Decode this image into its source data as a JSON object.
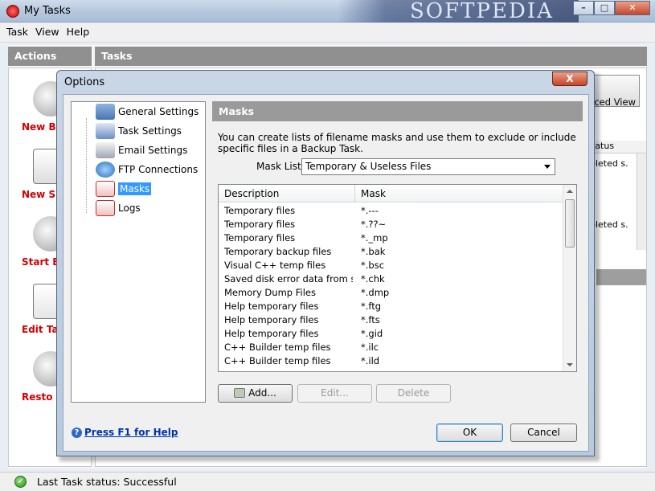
{
  "window": {
    "title": "My Tasks",
    "watermark": "SOFTPEDIA"
  },
  "menu": [
    "Task",
    "View",
    "Help"
  ],
  "actions_pane": {
    "header": "Actions",
    "items": [
      {
        "label": "New Ba",
        "icon": "cd-icon"
      },
      {
        "label": "New S",
        "icon": "new-task-icon"
      },
      {
        "label": "Start Ba",
        "icon": "start-backup-icon"
      },
      {
        "label": "Edit Ta",
        "icon": "edit-task-icon"
      },
      {
        "label": "Resto",
        "icon": "restore-icon"
      }
    ]
  },
  "tasks_pane": {
    "header": "Tasks",
    "advanced_view": "ced View",
    "status_col": "tatus",
    "rows": [
      "pleted s.",
      "pleted s."
    ]
  },
  "status_bar": {
    "text": "Last Task status: Successful"
  },
  "dialog": {
    "title": "Options",
    "close_label": "X",
    "tree": [
      {
        "label": "General Settings",
        "icon": "gear-icon"
      },
      {
        "label": "Task Settings",
        "icon": "task-icon"
      },
      {
        "label": "Email Settings",
        "icon": "email-icon"
      },
      {
        "label": "FTP Connections",
        "icon": "globe-icon"
      },
      {
        "label": "Masks",
        "icon": "mask-icon",
        "selected": true
      },
      {
        "label": "Logs",
        "icon": "log-icon"
      }
    ],
    "section_title": "Masks",
    "description": "You can create lists of filename masks and use them to exclude or include specific files in a Backup Task.",
    "mask_list_label": "Mask List:",
    "mask_list_value": "Temporary & Useless Files",
    "columns": [
      "Description",
      "Mask"
    ],
    "masks": [
      [
        "Temporary files",
        "*.---"
      ],
      [
        "Temporary files",
        "*.??~"
      ],
      [
        "Temporary files",
        "*._mp"
      ],
      [
        "Temporary backup files",
        "*.bak"
      ],
      [
        "Visual C++ temp files",
        "*.bsc"
      ],
      [
        "Saved disk error data from scan...",
        "*.chk"
      ],
      [
        "Memory Dump Files",
        "*.dmp"
      ],
      [
        "Help temporary files",
        "*.ftg"
      ],
      [
        "Help temporary files",
        "*.fts"
      ],
      [
        "Help temporary files",
        "*.gid"
      ],
      [
        "C++ Builder temp files",
        "*.ilc"
      ],
      [
        "C++ Builder temp files",
        "*.ild"
      ]
    ],
    "buttons": {
      "add": "Add...",
      "edit": "Edit...",
      "delete": "Delete",
      "ok": "OK",
      "cancel": "Cancel"
    },
    "help": "Press F1 for Help"
  },
  "colors": {
    "accent": "#3399ff",
    "header_grey": "#9a9a9a",
    "action_red": "#d20000",
    "link": "#0033aa"
  }
}
